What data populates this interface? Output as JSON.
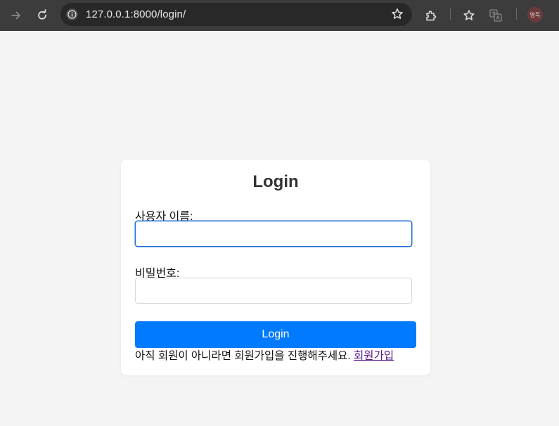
{
  "browser": {
    "url": "127.0.0.1:8000/login/",
    "profile_initials": "영득",
    "icons": {
      "forward": "arrow-right-icon",
      "reload": "reload-icon",
      "site_info": "info-icon",
      "bookmark": "star-icon",
      "extensions": "puzzle-icon",
      "reading_list": "bookmarks-star-icon",
      "translate": "translate-icon"
    }
  },
  "page": {
    "background": "#f4f4f4",
    "login_form": {
      "title": "Login",
      "username_label": "사용자 이름:",
      "username_value": "",
      "password_label": "비밀번호:",
      "password_value": "",
      "submit_label": "Login",
      "signup_prompt": "아직 회원이 아니라면 회원가입을 진행해주세요.",
      "signup_link": "회원가입"
    },
    "colors": {
      "primary_button": "#007bff",
      "focus_border": "#1f6fd6",
      "visited_link": "#551a8b"
    }
  }
}
